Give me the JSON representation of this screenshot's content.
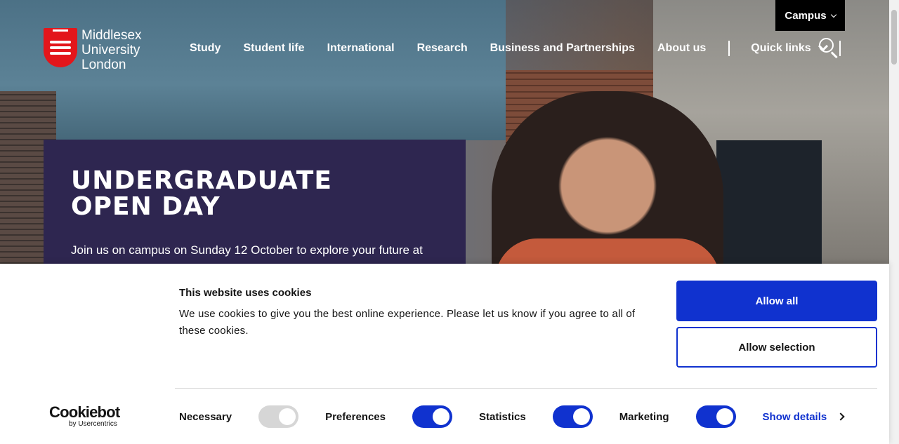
{
  "header": {
    "logo_lines": [
      "Middlesex",
      "University",
      "London"
    ],
    "campus_label": "Campus",
    "nav": [
      "Study",
      "Student life",
      "International",
      "Research",
      "Business and Partnerships",
      "About us"
    ],
    "quick_links": "Quick links"
  },
  "promo": {
    "title_line1": "UNDERGRADUATE",
    "title_line2": "OPEN DAY",
    "text": "Join us on campus on Sunday 12 October to explore your future at"
  },
  "cookie_banner": {
    "title": "This website uses cookies",
    "description": "We use cookies to give you the best online experience. Please let us know if you agree to all of these cookies.",
    "allow_all": "Allow all",
    "allow_selection": "Allow selection",
    "brand": "Cookiebot",
    "brand_sub": "by Usercentrics",
    "toggles": [
      {
        "label": "Necessary",
        "on": true,
        "disabled": true
      },
      {
        "label": "Preferences",
        "on": true,
        "disabled": false
      },
      {
        "label": "Statistics",
        "on": true,
        "disabled": false
      },
      {
        "label": "Marketing",
        "on": true,
        "disabled": false
      }
    ],
    "show_details": "Show details"
  },
  "colors": {
    "accent": "#1032cf",
    "promo_bg": "#2e2650",
    "logo_red": "#e3161b"
  }
}
